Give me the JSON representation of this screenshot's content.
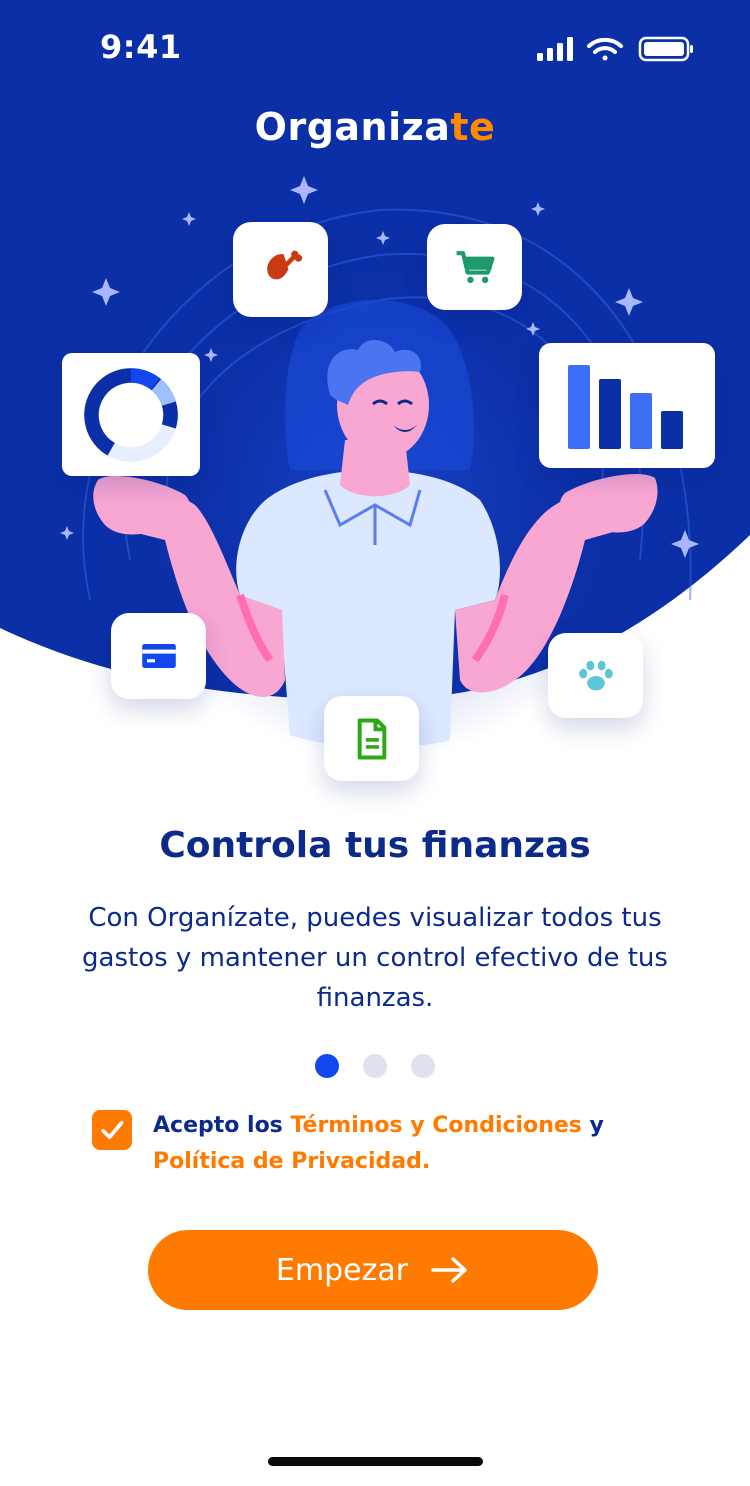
{
  "status_bar": {
    "time": "9:41"
  },
  "app_title": {
    "main": "Organiza",
    "accent": "te"
  },
  "headline": "Controla tus finanzas",
  "description": "Con Organízate, puedes visualizar todos tus gastos y mantener un control efectivo de tus finanzas.",
  "pagination": {
    "total": 3,
    "active": 1
  },
  "terms": {
    "checked": true,
    "prefix": "Acepto los ",
    "terms_link": "Términos y Condiciones",
    "conjunction": " y ",
    "privacy_link": "Política de Privacidad."
  },
  "cta": {
    "label": "Empezar"
  },
  "icons": {
    "food": "drumstick-icon",
    "cart": "shopping-cart-icon",
    "donut": "donut-chart-icon",
    "bars": "bar-chart-icon",
    "card": "credit-card-icon",
    "pet": "paw-icon",
    "doc": "document-icon"
  },
  "colors": {
    "brand_blue": "#0b2fa6",
    "accent_orange": "#ff7a00",
    "text_navy": "#0b2a8a",
    "dot_active": "#1347ee",
    "dot_inactive": "#dfe2ee"
  }
}
